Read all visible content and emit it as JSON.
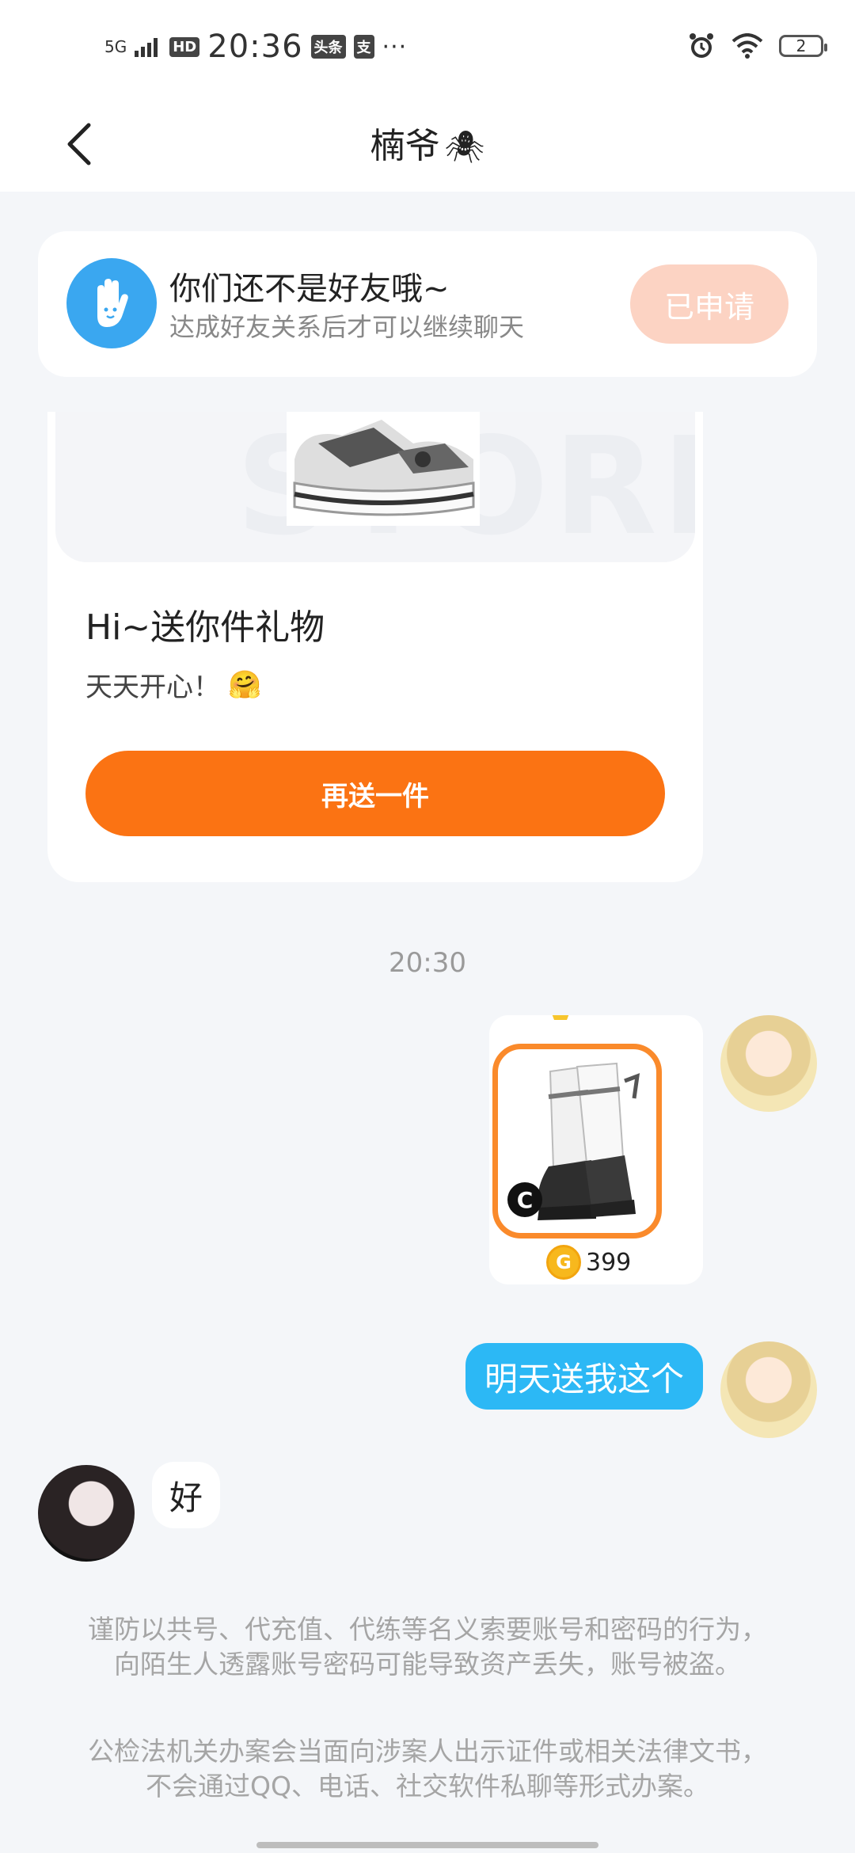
{
  "status_bar": {
    "network": "5G",
    "hd": "HD",
    "time": "20:36",
    "app_badge_1": "头条",
    "app_badge_2": "支",
    "more": "···",
    "battery": "2"
  },
  "navbar": {
    "title": "楠爷",
    "title_emoji": "🕷"
  },
  "friend_banner": {
    "title": "你们还不是好友哦~",
    "subtitle": "达成好友关系后才可以继续聊天",
    "button_label": "已申请"
  },
  "gift_card": {
    "bg_text": "STORE",
    "title": "Hi~送你件礼物",
    "message": "天天开心！",
    "message_emoji": "🤗",
    "button_label": "再送一件"
  },
  "timestamp": "20:30",
  "product_message": {
    "badge": "C",
    "price": "399",
    "coin_symbol": "G"
  },
  "messages": {
    "me_text": "明天送我这个",
    "other_text": "好"
  },
  "notices": {
    "warning_1": "谨防以共号、代充值、代练等名义索要账号和密码的行为，向陌生人透露账号密码可能导致资产丢失，账号被盗。",
    "warning_2": "公检法机关办案会当面向涉案人出示证件或相关法律文书，不会通过QQ、电话、社交软件私聊等形式办案。"
  },
  "colors": {
    "accent_orange": "#fb7313",
    "bubble_blue": "#2cb8f5",
    "applied_bg": "#fcd3c3",
    "banner_avatar": "#3aa7f0"
  }
}
